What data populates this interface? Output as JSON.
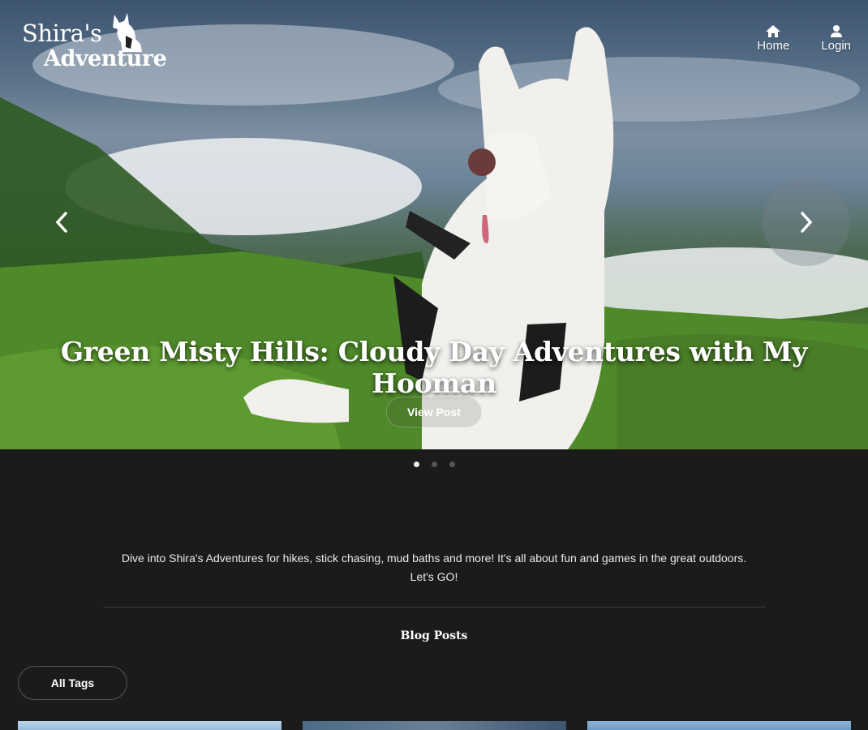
{
  "logo": {
    "line1": "Shira's",
    "line2": "Adventure",
    "icon": "dog-icon"
  },
  "nav": {
    "home": {
      "label": "Home",
      "icon": "home-icon"
    },
    "login": {
      "label": "Login",
      "icon": "user-icon"
    }
  },
  "hero": {
    "title": "Green Misty Hills: Cloudy Day Adventures with My Hooman",
    "button_label": "View Post",
    "prev_icon": "chevron-left-icon",
    "next_icon": "chevron-right-icon",
    "slides_total": 3,
    "active_slide": 1
  },
  "intro": "Dive into Shira's Adventures for hikes, stick chasing, mud baths and more! It's all about fun and games in the great outdoors. Let's GO!",
  "blog": {
    "heading": "Blog Posts",
    "tags_button": "All Tags"
  },
  "colors": {
    "background": "#1b1b1c",
    "text": "#ffffff",
    "dot_active": "#eeeeee",
    "dot_inactive": "#555555"
  }
}
